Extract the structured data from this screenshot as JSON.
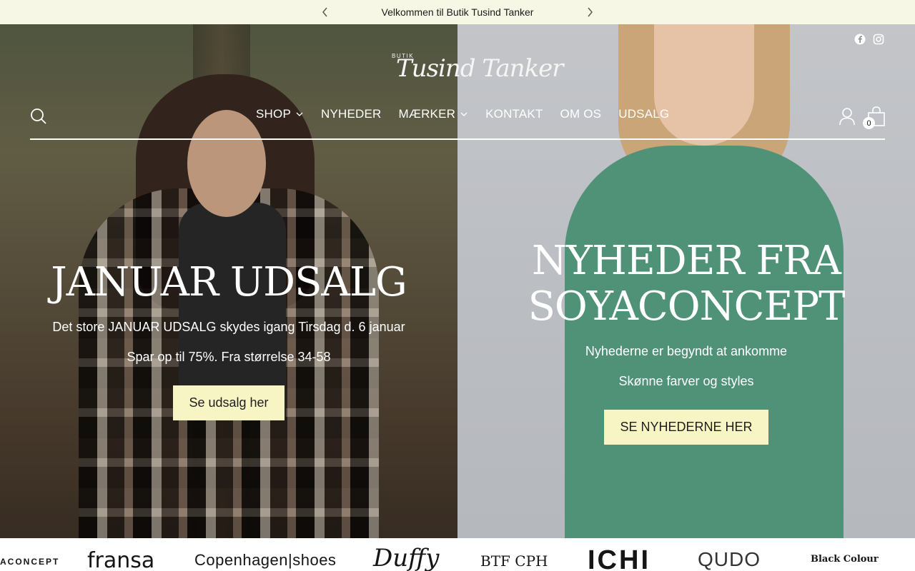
{
  "announcement": {
    "text": "Velkommen til Butik Tusind Tanker"
  },
  "logo": {
    "small": "BUTIK",
    "script": "Tusind Tanker"
  },
  "nav": {
    "items": [
      {
        "label": "SHOP",
        "has_dropdown": true
      },
      {
        "label": "NYHEDER",
        "has_dropdown": false
      },
      {
        "label": "MÆRKER",
        "has_dropdown": true
      },
      {
        "label": "KONTAKT",
        "has_dropdown": false
      },
      {
        "label": "OM OS",
        "has_dropdown": false
      },
      {
        "label": "UDSALG",
        "has_dropdown": false
      }
    ]
  },
  "cart": {
    "count": "0"
  },
  "hero_left": {
    "title": "JANUAR UDSALG",
    "line1": "Det store JANUAR UDSALG skydes igang Tirsdag d. 6 januar",
    "line2": "Spar op til 75%. Fra størrelse 34-58",
    "button": "Se udsalg her"
  },
  "hero_right": {
    "title_line1": "NYHEDER FRA",
    "title_line2": "SOYACONCEPT",
    "line1": "Nyhederne er begyndt at ankomme",
    "line2": "Skønne farver og styles",
    "button": "SE NYHEDERNE HER"
  },
  "brands": [
    "ACONCEPT",
    "fransa",
    "Copenhagen|shoes",
    "Duffy",
    "BTF CPH",
    "ICHI",
    "QUDO",
    "Black Colour"
  ],
  "colors": {
    "announcement_bg": "#f7f7e6",
    "button_bg": "#f8f5c4",
    "text_light": "#ffffff"
  },
  "icons": [
    "chevron-left-icon",
    "chevron-right-icon",
    "facebook-icon",
    "instagram-icon",
    "search-icon",
    "account-icon",
    "bag-icon"
  ]
}
